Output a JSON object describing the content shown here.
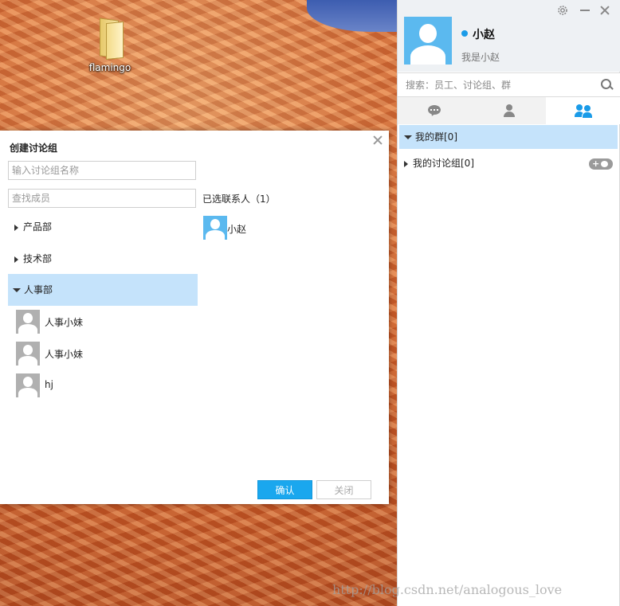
{
  "desktop": {
    "icons": [
      {
        "label": "flamingo",
        "icon": "folder-icon"
      }
    ]
  },
  "dialog": {
    "title": "创建讨论组",
    "group_name_placeholder": "输入讨论组名称",
    "member_search_placeholder": "查找成员",
    "departments": [
      {
        "label": "产品部",
        "expanded": false
      },
      {
        "label": "技术部",
        "expanded": false
      },
      {
        "label": "人事部",
        "expanded": true
      }
    ],
    "members": [
      {
        "name": "人事小妹"
      },
      {
        "name": "人事小妹"
      },
      {
        "name": "hj"
      }
    ],
    "selected_label": "已选联系人（1）",
    "selected_contacts": [
      {
        "name": "小赵"
      }
    ],
    "confirm_label": "确认",
    "close_label": "关闭"
  },
  "panel": {
    "user": {
      "name": "小赵",
      "signature": "我是小赵",
      "status_color": "#1a9be8"
    },
    "search_placeholder": "搜索：员工、讨论组、群",
    "tabs": [
      {
        "icon": "chat-icon",
        "active": false
      },
      {
        "icon": "person-icon",
        "active": false
      },
      {
        "icon": "group-icon",
        "active": true
      }
    ],
    "groups": [
      {
        "label": "我的群[0]",
        "expanded": true
      },
      {
        "label": "我的讨论组[0]",
        "expanded": false
      }
    ]
  },
  "watermark": "http://blog.csdn.net/analogous_love",
  "colors": {
    "accent": "#1aa7ee",
    "selection": "#c5e3fb"
  }
}
